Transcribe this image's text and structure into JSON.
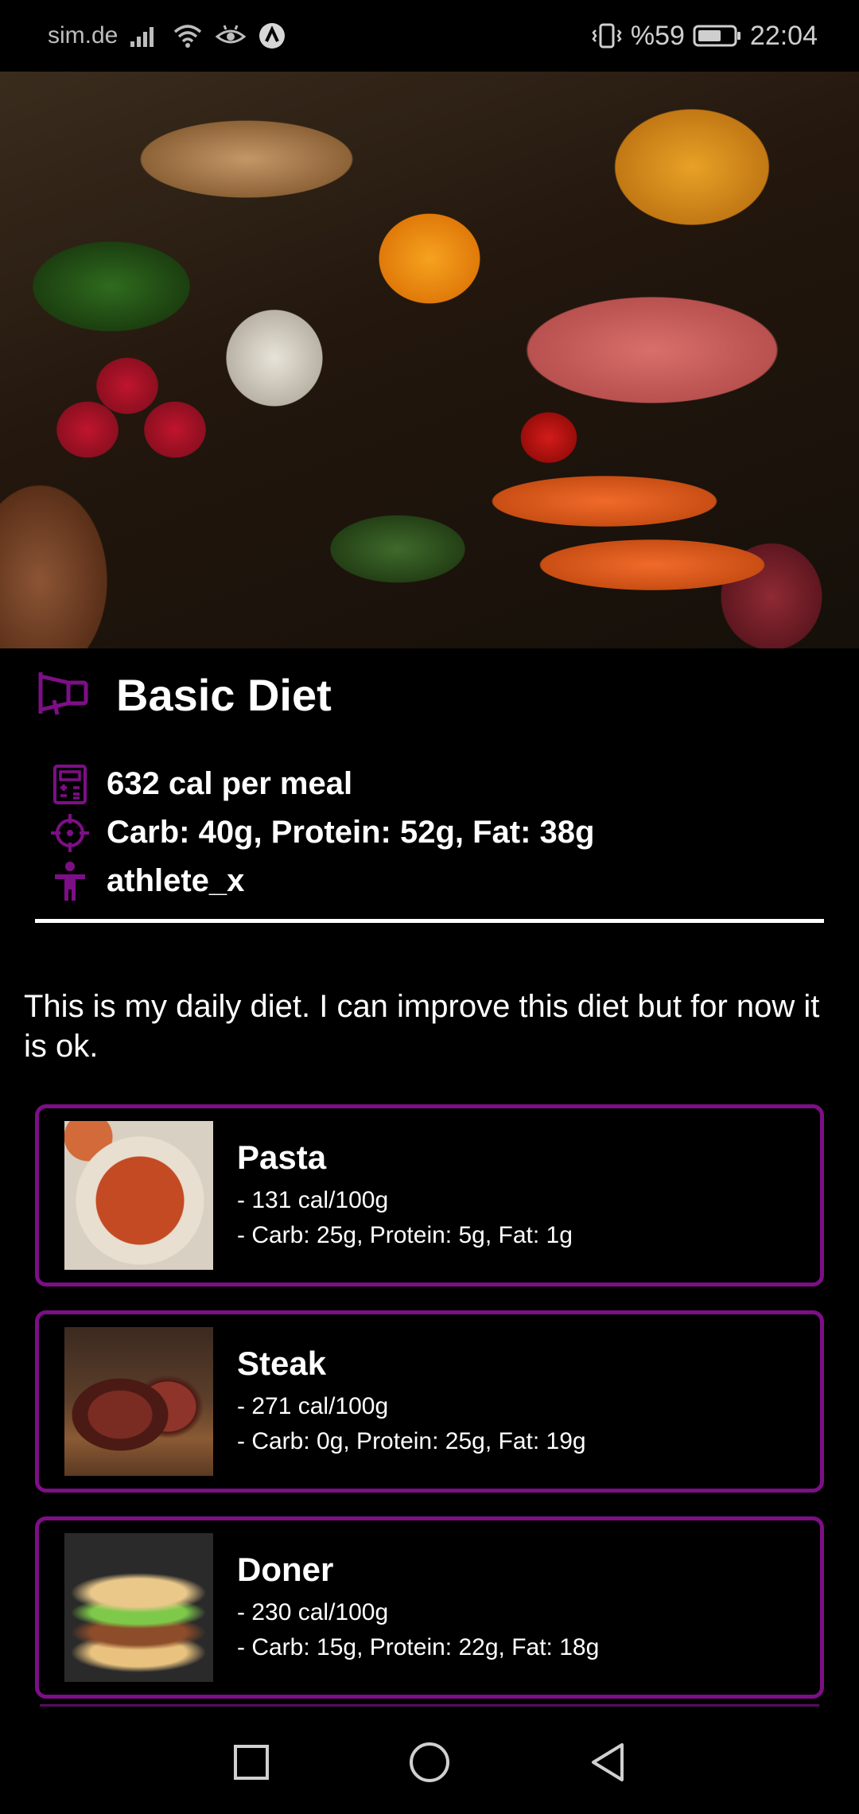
{
  "status_bar": {
    "carrier": "sim.de",
    "battery_percent": "%59",
    "time": "22:04",
    "icons": [
      "signal-icon",
      "wifi-icon",
      "eye-comfort-icon",
      "app-notification-icon",
      "vibrate-icon",
      "battery-icon"
    ]
  },
  "hero": {
    "image": "diet-hero-image"
  },
  "diet": {
    "title": "Basic Diet",
    "title_icon": "megaphone-icon",
    "calories": "632 cal per meal",
    "macros": "Carb: 40g, Protein: 52g, Fat: 38g",
    "author": "athlete_x",
    "description": "This is my daily diet. I can improve this diet but for now it is ok."
  },
  "foods": [
    {
      "name": "Pasta",
      "calories": "- 131 cal/100g",
      "macros": "- Carb: 25g, Protein: 5g, Fat: 1g"
    },
    {
      "name": "Steak",
      "calories": "- 271 cal/100g",
      "macros": "- Carb: 0g, Protein: 25g, Fat: 19g"
    },
    {
      "name": "Doner",
      "calories": "- 230 cal/100g",
      "macros": "- Carb: 15g, Protein: 22g, Fat: 18g"
    }
  ],
  "colors": {
    "accent": "#7d0f86",
    "background": "#000000",
    "text": "#ffffff"
  },
  "nav_bar": {
    "recents": "recents-icon",
    "home": "home-icon",
    "back": "back-icon"
  }
}
